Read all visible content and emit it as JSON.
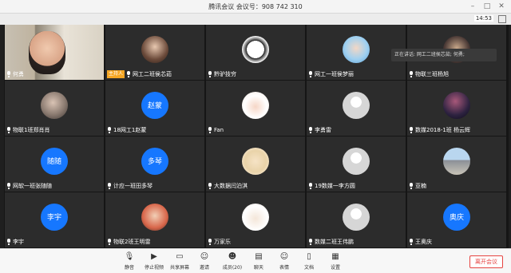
{
  "window": {
    "title": "腾讯会议 会议号：908 742 310"
  },
  "status": {
    "clock": "14:53"
  },
  "speaking": {
    "label": "正在讲话: 网工二班侯芯茹; 何勇;"
  },
  "colors": {
    "accent": "#1a73e8",
    "avatar_blue": "#1677ff",
    "host_badge": "#f5a623",
    "leave": "#e64340"
  },
  "participants": [
    {
      "name": "何勇",
      "avatar_text": "",
      "style": "video",
      "host": false
    },
    {
      "name": "网工二班侯芯茹",
      "avatar_text": "",
      "style": "photo1",
      "host": true,
      "host_label": "主持人"
    },
    {
      "name": "黔驴技穷",
      "avatar_text": "",
      "style": "photo2",
      "host": false
    },
    {
      "name": "网工一班侯梦丽",
      "avatar_text": "",
      "style": "photo3",
      "host": false
    },
    {
      "name": "物联三班杨旭",
      "avatar_text": "",
      "style": "photo4",
      "host": false
    },
    {
      "name": "物联1班郑肖肖",
      "avatar_text": "",
      "style": "photo5",
      "host": false
    },
    {
      "name": "18网工1赵蒙",
      "avatar_text": "赵蒙",
      "style": "blue",
      "host": false
    },
    {
      "name": "Fan",
      "avatar_text": "",
      "style": "photo6",
      "host": false
    },
    {
      "name": "李勇雷",
      "avatar_text": "",
      "style": "default",
      "host": false
    },
    {
      "name": "数媒2018-1班 杨云辉",
      "avatar_text": "",
      "style": "photo7",
      "host": false
    },
    {
      "name": "网软一班张随随",
      "avatar_text": "随随",
      "style": "blue",
      "host": false
    },
    {
      "name": "计应一班田多琴",
      "avatar_text": "多琴",
      "style": "blue",
      "host": false
    },
    {
      "name": "大数据闫泊淇",
      "avatar_text": "",
      "style": "photo8",
      "host": false
    },
    {
      "name": "19数媒一李方圆",
      "avatar_text": "",
      "style": "default",
      "host": false
    },
    {
      "name": "亚楠",
      "avatar_text": "",
      "style": "photo9",
      "host": false
    },
    {
      "name": "李宇",
      "avatar_text": "李宇",
      "style": "blue",
      "host": false
    },
    {
      "name": "物联2班王明雷",
      "avatar_text": "",
      "style": "photo10",
      "host": false
    },
    {
      "name": "万家乐",
      "avatar_text": "",
      "style": "photo11",
      "host": false
    },
    {
      "name": "数媒二班王伟鹏",
      "avatar_text": "",
      "style": "default",
      "host": false
    },
    {
      "name": "王奥庆",
      "avatar_text": "奥庆",
      "style": "blue",
      "host": false
    }
  ],
  "toolbar": {
    "items": [
      {
        "label": "静音",
        "icon": "microphone-icon",
        "glyph": "🎙"
      },
      {
        "label": "停止视频",
        "icon": "camera-icon",
        "glyph": "▶"
      },
      {
        "label": "共享屏幕",
        "icon": "share-screen-icon",
        "glyph": "▭"
      },
      {
        "label": "邀请",
        "icon": "invite-icon",
        "glyph": "☺"
      },
      {
        "label": "成员(20)",
        "icon": "members-icon",
        "glyph": "☻"
      },
      {
        "label": "聊天",
        "icon": "chat-icon",
        "glyph": "▤"
      },
      {
        "label": "表情",
        "icon": "emoji-icon",
        "glyph": "☺"
      },
      {
        "label": "文档",
        "icon": "document-icon",
        "glyph": "▯"
      },
      {
        "label": "设置",
        "icon": "settings-icon",
        "glyph": "▦"
      }
    ],
    "leave": "离开会议"
  }
}
